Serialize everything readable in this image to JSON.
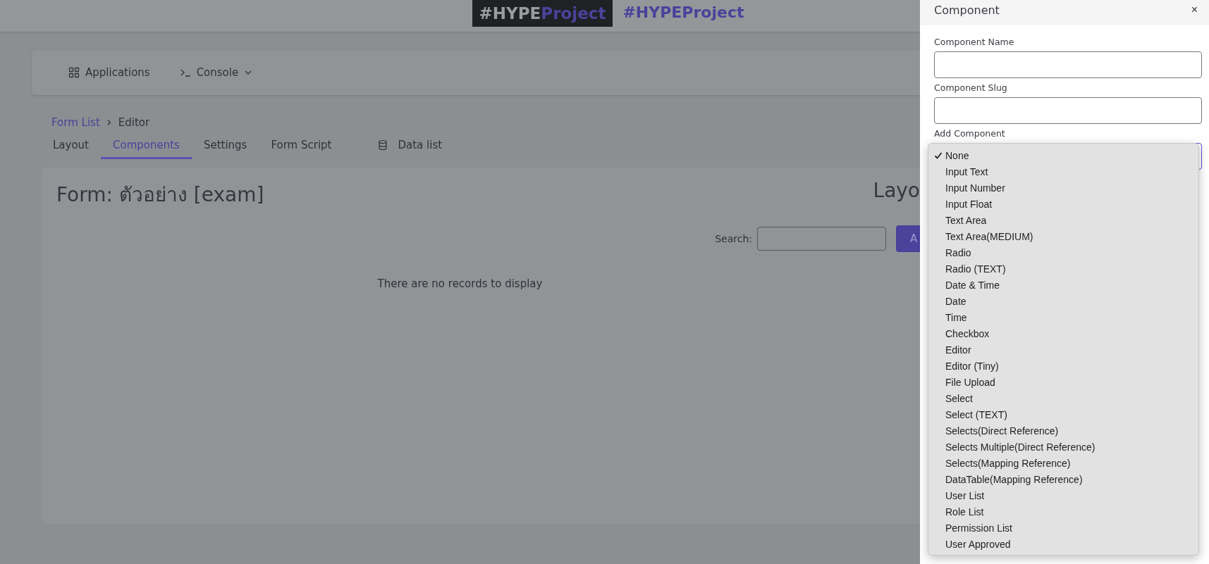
{
  "header": {
    "logo": {
      "part1": "#HYPE",
      "part2": "Project"
    },
    "brand": "#HYPEProject"
  },
  "nav": [
    {
      "label": "Applications",
      "kind": "grid",
      "has_menu": false
    },
    {
      "label": "Console",
      "kind": "prompt",
      "has_menu": true
    }
  ],
  "breadcrumb": [
    "Form List",
    "Editor"
  ],
  "tabs": [
    {
      "label": "Layout",
      "selected": false,
      "kind": "plain"
    },
    {
      "label": "Components",
      "selected": true,
      "kind": "plain"
    },
    {
      "label": "Settings",
      "selected": false,
      "kind": "plain"
    },
    {
      "label": "Form Script",
      "selected": false,
      "kind": "plain"
    },
    {
      "label": "Data list",
      "selected": false,
      "kind": "database"
    }
  ],
  "card": {
    "title": "Form: ตัวอย่าง [exam]",
    "title_2": "Layo",
    "search_label": "Search:",
    "button": "A",
    "empty": "There are no records to display"
  },
  "panel": {
    "title": "Component",
    "close": "×",
    "fields": [
      {
        "label": "Component Name"
      },
      {
        "label": "Component Slug"
      }
    ],
    "select_label": "Add Component",
    "options": [
      {
        "label": "None",
        "selected": true
      },
      {
        "label": "Input Text",
        "selected": false
      },
      {
        "label": "Input Number",
        "selected": false
      },
      {
        "label": "Input Float",
        "selected": false
      },
      {
        "label": "Text Area",
        "selected": false
      },
      {
        "label": "Text Area(MEDIUM)",
        "selected": false
      },
      {
        "label": "Radio",
        "selected": false
      },
      {
        "label": "Radio (TEXT)",
        "selected": false
      },
      {
        "label": "Date & Time",
        "selected": false
      },
      {
        "label": "Date",
        "selected": false
      },
      {
        "label": "Time",
        "selected": false
      },
      {
        "label": "Checkbox",
        "selected": false
      },
      {
        "label": "Editor",
        "selected": false
      },
      {
        "label": "Editor (Tiny)",
        "selected": false
      },
      {
        "label": "File Upload",
        "selected": false
      },
      {
        "label": "Select",
        "selected": false
      },
      {
        "label": "Select (TEXT)",
        "selected": false
      },
      {
        "label": "Selects(Direct Reference)",
        "selected": false
      },
      {
        "label": "Selects Multiple(Direct Reference)",
        "selected": false
      },
      {
        "label": "Selects(Mapping Reference)",
        "selected": false
      },
      {
        "label": "DataTable(Mapping Reference)",
        "selected": false
      },
      {
        "label": "User List",
        "selected": false
      },
      {
        "label": "Role List",
        "selected": false
      },
      {
        "label": "Permission List",
        "selected": false
      },
      {
        "label": "User Approved",
        "selected": false
      }
    ]
  }
}
